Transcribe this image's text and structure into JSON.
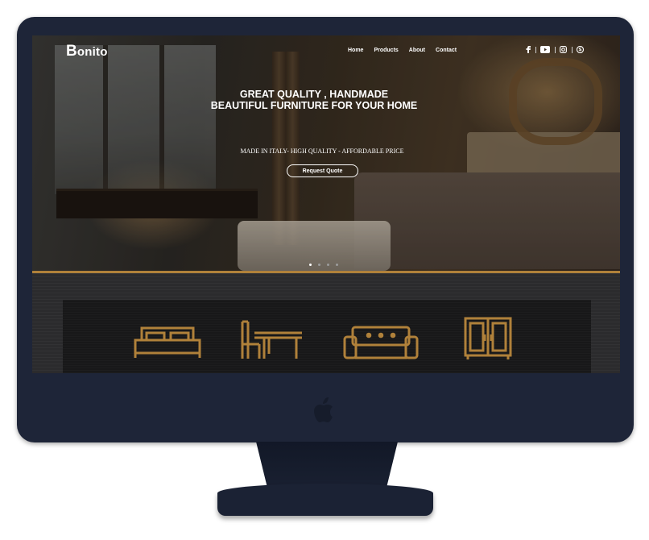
{
  "brand": {
    "logo_initial": "B",
    "logo_rest": "onito"
  },
  "nav": {
    "items": [
      "Home",
      "Products",
      "About",
      "Contact"
    ]
  },
  "social": {
    "icons": [
      "facebook-icon",
      "youtube-icon",
      "instagram-icon",
      "skype-icon"
    ]
  },
  "hero": {
    "headline_line1": "GREAT QUALITY , HANDMADE",
    "headline_line2": "BEAUTIFUL FURNITURE FOR YOUR HOME",
    "subline": "MADE IN ITALY- HIGH QUALITY - AFFORDABLE PRICE",
    "cta_label": "Request Quote",
    "slides_total": 4,
    "active_slide": 1
  },
  "categories": {
    "icons": [
      "bed-icon",
      "dining-table-chair-icon",
      "sofa-icon",
      "wardrobe-icon"
    ],
    "icon_color": "#b0813a"
  },
  "colors": {
    "monitor": "#1e2538",
    "accent_gold": "#b0813a"
  }
}
